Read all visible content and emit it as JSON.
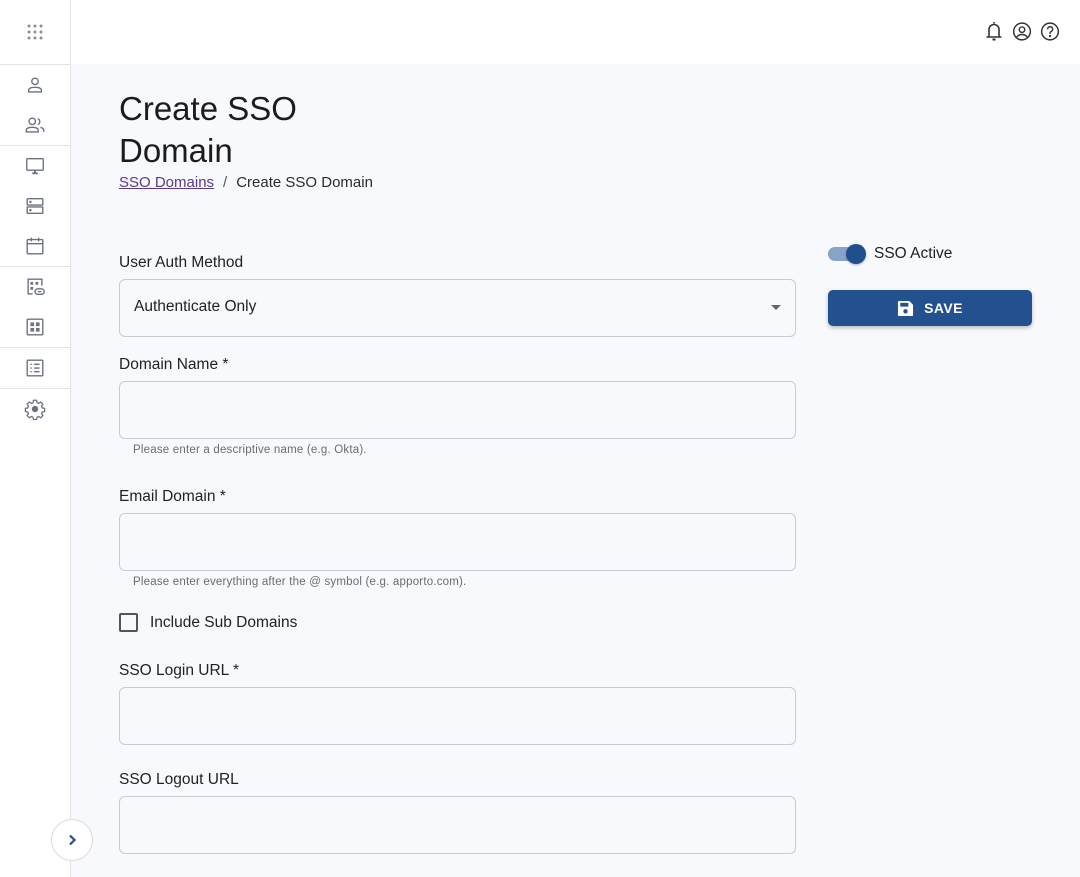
{
  "sidebar": {
    "apps_icon": "apps-grid-icon",
    "groups": [
      [
        {
          "name": "user-icon",
          "label": "User"
        },
        {
          "name": "users-icon",
          "label": "Users"
        }
      ],
      [
        {
          "name": "monitor-icon",
          "label": "Desktops"
        },
        {
          "name": "server-icon",
          "label": "Servers"
        },
        {
          "name": "calendar-icon",
          "label": "Calendar"
        }
      ],
      [
        {
          "name": "linked-apps-icon",
          "label": "Linked Apps"
        },
        {
          "name": "apps-icon",
          "label": "Apps"
        }
      ],
      [
        {
          "name": "list-icon",
          "label": "Lists"
        }
      ],
      [
        {
          "name": "gear-icon",
          "label": "Settings"
        }
      ]
    ],
    "collapse_icon": "chevron-right-icon"
  },
  "header": {
    "icons": [
      "bell-icon",
      "account-icon",
      "help-icon"
    ]
  },
  "page": {
    "title": "Create SSO Domain",
    "breadcrumb": {
      "parent": "SSO Domains",
      "separator": "/",
      "current": "Create SSO Domain"
    }
  },
  "form": {
    "auth_method": {
      "label": "User Auth Method",
      "value": "Authenticate Only"
    },
    "domain_name": {
      "label": "Domain Name *",
      "value": "",
      "helper": "Please enter a descriptive name (e.g. Okta)."
    },
    "email_domain": {
      "label": "Email Domain *",
      "value": "",
      "helper": "Please enter everything after the @ symbol (e.g. apporto.com)."
    },
    "include_sub_domains": {
      "label": "Include Sub Domains",
      "checked": false
    },
    "sso_login_url": {
      "label": "SSO Login URL *",
      "value": ""
    },
    "sso_logout_url": {
      "label": "SSO Logout URL",
      "value": ""
    }
  },
  "actions": {
    "sso_active": {
      "label": "SSO Active",
      "on": true
    },
    "save_label": "SAVE"
  },
  "colors": {
    "primary": "#23508f",
    "link": "#5a3a8a",
    "background": "#f8f9fc"
  }
}
